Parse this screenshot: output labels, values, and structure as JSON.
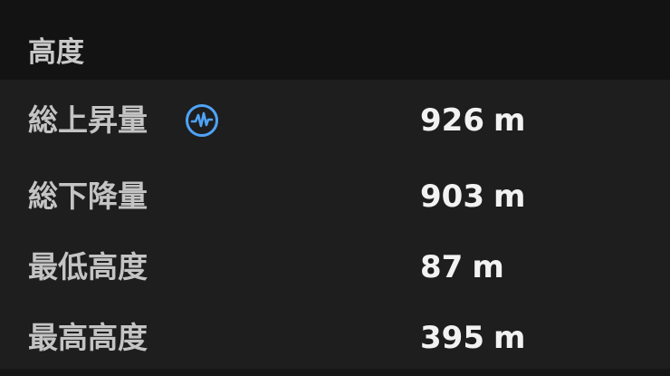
{
  "section": {
    "title": "高度"
  },
  "stats": [
    {
      "label": "総上昇量",
      "value": "926",
      "unit": "m",
      "icon": "pulse-info-icon"
    },
    {
      "label": "総下降量",
      "value": "903",
      "unit": "m"
    },
    {
      "label": "最低高度",
      "value": "87",
      "unit": "m"
    },
    {
      "label": "最高高度",
      "value": "395",
      "unit": "m"
    }
  ],
  "colors": {
    "background": "#131313",
    "panel": "#1e1e1e",
    "label_text": "#c4c4c4",
    "value_text": "#f2f2f2",
    "accent_icon": "#4fa3f7"
  }
}
